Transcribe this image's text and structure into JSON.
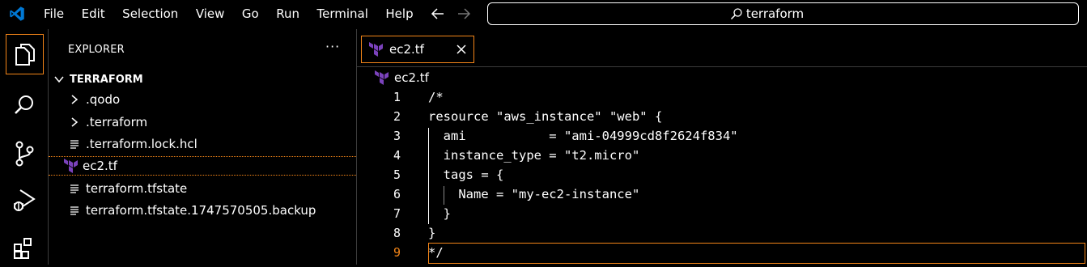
{
  "titlebar": {
    "menu": [
      "File",
      "Edit",
      "Selection",
      "View",
      "Go",
      "Run",
      "Terminal",
      "Help"
    ],
    "search_text": "terraform"
  },
  "sidebar": {
    "title": "EXPLORER",
    "more_label": "···",
    "root_folder": "TERRAFORM",
    "items": [
      {
        "label": ".qodo",
        "type": "folder"
      },
      {
        "label": ".terraform",
        "type": "folder"
      },
      {
        "label": ".terraform.lock.hcl",
        "type": "file"
      },
      {
        "label": "ec2.tf",
        "type": "terraform",
        "selected": true
      },
      {
        "label": "terraform.tfstate",
        "type": "file"
      },
      {
        "label": "terraform.tfstate.1747570505.backup",
        "type": "file"
      }
    ]
  },
  "editor": {
    "tab_label": "ec2.tf",
    "breadcrumb": "ec2.tf",
    "current_line": 9,
    "lines": [
      {
        "n": "1",
        "text": "/*"
      },
      {
        "n": "2",
        "text": "resource \"aws_instance\" \"web\" {"
      },
      {
        "n": "3",
        "text": "  ami           = \"ami-04999cd8f2624f834\""
      },
      {
        "n": "4",
        "text": "  instance_type = \"t2.micro\""
      },
      {
        "n": "5",
        "text": "  tags = {"
      },
      {
        "n": "6",
        "text": "    Name = \"my-ec2-instance\""
      },
      {
        "n": "7",
        "text": "  }"
      },
      {
        "n": "8",
        "text": "}"
      },
      {
        "n": "9",
        "text": "*/"
      }
    ]
  },
  "colors": {
    "accent": "#f38518",
    "terraform_purple": "#7b42bc",
    "vscode_blue": "#0078d4"
  }
}
